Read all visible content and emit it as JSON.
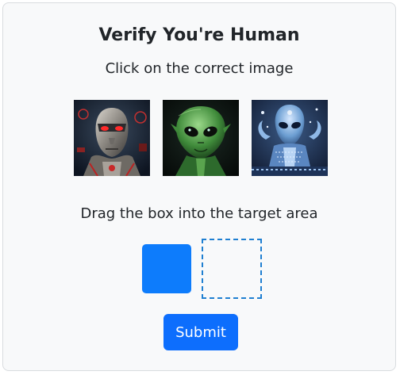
{
  "header": {
    "title": "Verify You're Human",
    "instruction": "Click on the correct image"
  },
  "images": [
    {
      "name": "robot-alien-image",
      "icon": "cyborg-face"
    },
    {
      "name": "green-alien-image",
      "icon": "green-alien-face"
    },
    {
      "name": "blue-alien-image",
      "icon": "blue-alien-ornate"
    }
  ],
  "drag": {
    "instruction": "Drag the box into the target area"
  },
  "actions": {
    "submit_label": "Submit"
  },
  "colors": {
    "accent": "#0d6efd",
    "drag_box": "#0d7cfc",
    "target_border": "#1f7fd1"
  }
}
